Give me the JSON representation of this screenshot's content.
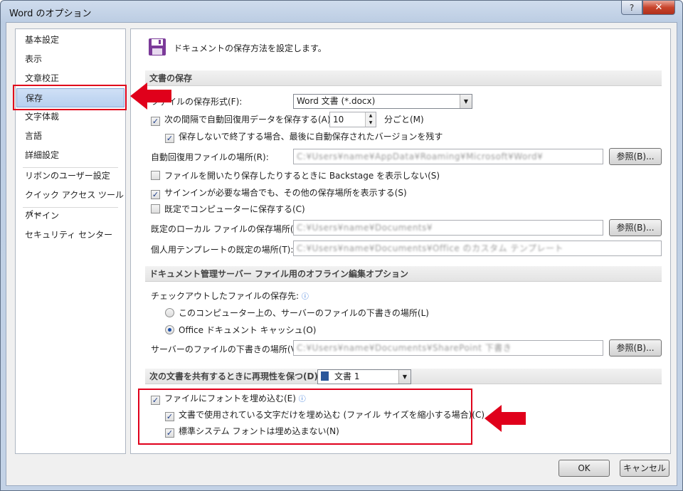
{
  "window": {
    "title": "Word のオプション",
    "help": "?",
    "close": "✕"
  },
  "nav": {
    "items": [
      "基本設定",
      "表示",
      "文章校正",
      "保存",
      "文字体裁",
      "言語",
      "詳細設定",
      "リボンのユーザー設定",
      "クイック アクセス ツール バー",
      "アドイン",
      "セキュリティ センター"
    ],
    "selected": "保存"
  },
  "main": {
    "title": "ドキュメントの保存方法を設定します。",
    "save_section": {
      "header": "文書の保存",
      "format_label": "ファイルの保存形式(F):",
      "format_value": "Word 文書 (*.docx)",
      "autorecover_label": "次の間隔で自動回復用データを保存する(A):",
      "autorecover_checked": true,
      "interval_value": "10",
      "interval_unit": "分ごと(M)",
      "keep_last_label": "保存しないで終了する場合、最後に自動保存されたバージョンを残す",
      "keep_last_checked": true,
      "autorecover_path_label": "自動回復用ファイルの場所(R):",
      "autorecover_path": "C:¥Users¥name¥AppData¥Roaming¥Microsoft¥Word¥",
      "browse_label": "参照(B)...",
      "backstage_label": "ファイルを開いたり保存したりするときに Backstage を表示しない(S)",
      "backstage_checked": false,
      "signin_label": "サインインが必要な場合でも、その他の保存場所を表示する(S)",
      "signin_checked": true,
      "default_computer_label": "既定でコンピューターに保存する(C)",
      "default_computer_checked": false,
      "local_path_label": "既定のローカル ファイルの保存場所(I):",
      "local_path": "C:¥Users¥name¥Documents¥",
      "template_path_label": "個人用テンプレートの既定の場所(T):",
      "template_path": "C:¥Users¥name¥Documents¥Office のカスタム テンプレート"
    },
    "server_section": {
      "header": "ドキュメント管理サーバー ファイル用のオフライン編集オプション",
      "checkout_label": "チェックアウトしたファイルの保存先:",
      "option_local": "このコンピューター上の、サーバーのファイルの下書きの場所(L)",
      "option_cache": "Office ドキュメント キャッシュ(O)",
      "selected": "cache",
      "drafts_label": "サーバーのファイルの下書きの場所(V):",
      "drafts_path": "C:¥Users¥name¥Documents¥SharePoint 下書き"
    },
    "fidelity_section": {
      "header": "次の文書を共有するときに再現性を保つ(D):",
      "doc_value": "文書 1",
      "embed_fonts_label": "ファイルにフォントを埋め込む(E)",
      "embed_fonts_checked": true,
      "used_chars_label": "文書で使用されている文字だけを埋め込む (ファイル サイズを縮小する場合)(C)",
      "used_chars_checked": true,
      "no_system_label": "標準システム フォントは埋め込まない(N)",
      "no_system_checked": true
    }
  },
  "buttons": {
    "ok": "OK",
    "cancel": "キャンセル"
  },
  "colors": {
    "highlight_red": "#e0001b",
    "selected_nav": "#c5d9f1"
  }
}
